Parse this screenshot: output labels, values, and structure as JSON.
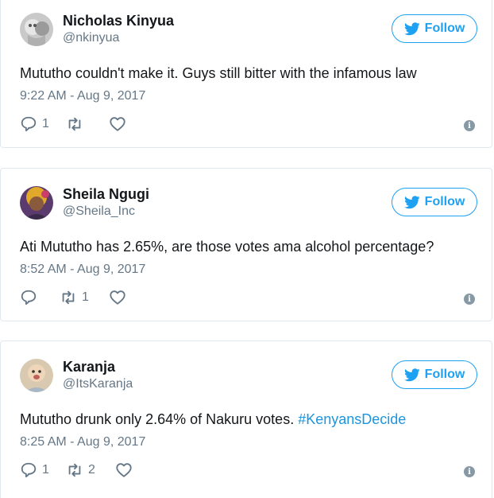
{
  "tweets": [
    {
      "name": "Nicholas Kinyua",
      "handle": "@nkinyua",
      "text": "Mututho couldn't make it. Guys still bitter with the infamous law",
      "hashtag": "",
      "time": "9:22 AM - Aug 9, 2017",
      "replies": "1",
      "retweets": "",
      "likes": "",
      "follow_label": "Follow"
    },
    {
      "name": "Sheila Ngugi",
      "handle": "@Sheila_Inc",
      "text": "Ati Mututho has 2.65%, are those votes ama alcohol percentage?",
      "hashtag": "",
      "time": "8:52 AM - Aug 9, 2017",
      "replies": "",
      "retweets": "1",
      "likes": "",
      "follow_label": "Follow"
    },
    {
      "name": "Karanja",
      "handle": "@ItsKaranja",
      "text": "Mututho drunk only 2.64% of Nakuru votes. ",
      "hashtag": "#KenyansDecide",
      "time": "8:25 AM - Aug 9, 2017",
      "replies": "1",
      "retweets": "2",
      "likes": "",
      "follow_label": "Follow"
    }
  ],
  "colors": {
    "accent": "#1da1f2",
    "hashtag": "#1b95e0",
    "secondary_text": "#657786",
    "border": "#e1e8ed",
    "info_icon": "#8899a6"
  },
  "icons": {
    "follow": "twitter-bird-icon",
    "reply": "reply-icon",
    "retweet": "retweet-icon",
    "like": "heart-icon",
    "info": "info-icon"
  }
}
